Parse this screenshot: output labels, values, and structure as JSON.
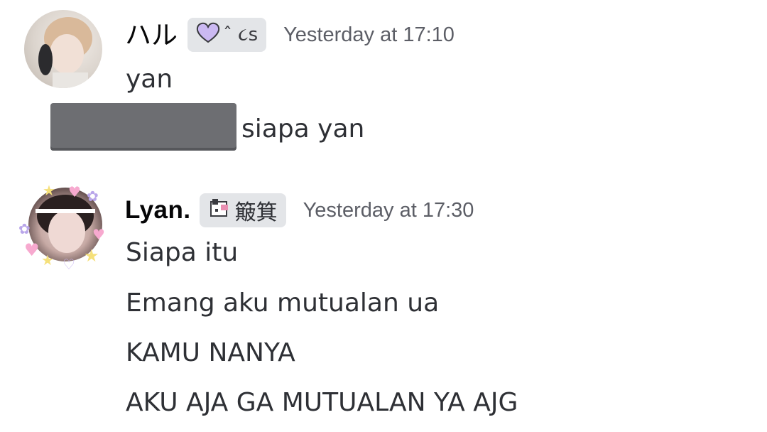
{
  "messages": [
    {
      "username": "ハル",
      "tag_text": "ˆ ૮ꜱ",
      "timestamp": "Yesterday at 17:10",
      "lines": [
        "yan",
        "siapa yan"
      ],
      "avatar_icon": "avatar-photo",
      "tag_icon": "heart-icon",
      "has_spoiler": true
    },
    {
      "username": "Lyan.",
      "tag_text": "簸箕",
      "timestamp": "Yesterday at 17:30",
      "lines": [
        "Siapa itu",
        "Emang aku mutualan ua",
        "KAMU NANYA",
        "AKU AJA GA MUTUALAN YA AJG"
      ],
      "avatar_icon": "avatar-photo",
      "tag_icon": "dog-icon"
    }
  ],
  "colors": {
    "background": "#ffffff",
    "tag_bg": "#e3e5e8",
    "timestamp": "#5c5e66",
    "spoiler": "#6d6e72",
    "heart": "#cbb9f2"
  }
}
